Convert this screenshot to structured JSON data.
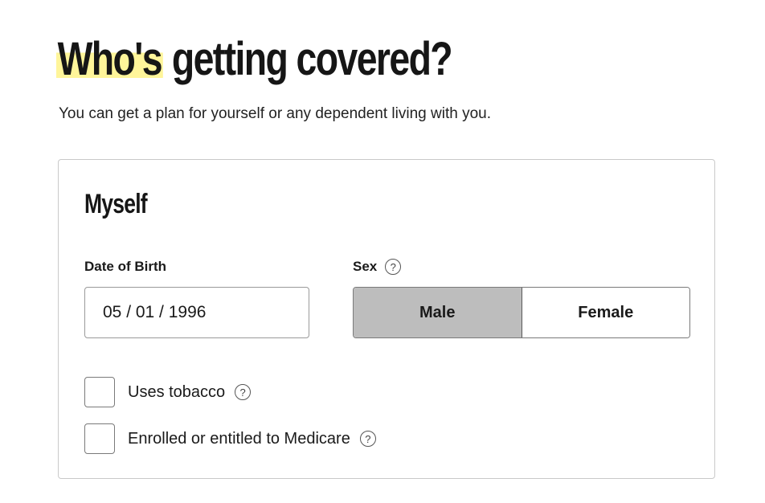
{
  "header": {
    "title_highlight": "Who's",
    "title_rest": "getting covered?",
    "subtitle": "You can get a plan for yourself or any dependent living with you."
  },
  "card": {
    "title": "Myself",
    "dob": {
      "label": "Date of Birth",
      "value": "05 / 01 / 1996"
    },
    "sex": {
      "label": "Sex",
      "options": [
        "Male",
        "Female"
      ],
      "selected": "Male"
    },
    "checkboxes": [
      {
        "label": "Uses tobacco",
        "checked": false
      },
      {
        "label": "Enrolled or entitled to Medicare",
        "checked": false
      }
    ],
    "help_glyph": "?"
  },
  "colors": {
    "highlight": "#fff59a",
    "selected_option": "#bdbdbd",
    "card_border": "#c9c9c9"
  },
  "icons": {
    "help": "question-circle-icon"
  }
}
